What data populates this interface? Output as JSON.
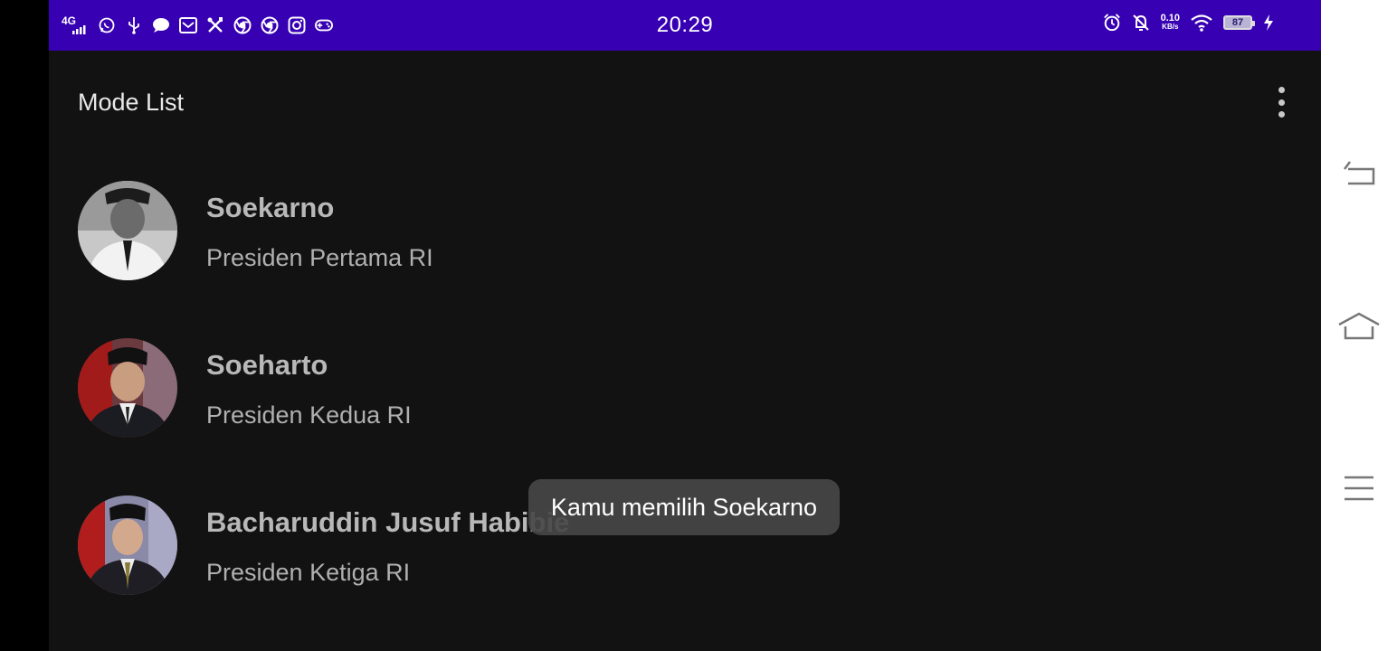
{
  "status_bar": {
    "time": "20:29",
    "network": "4G",
    "net_speed_value": "0.10",
    "net_speed_unit": "KB/s",
    "battery": "87",
    "left_icons": [
      "whatsapp-icon",
      "usb-icon",
      "message-icon",
      "mail-icon",
      "tools-icon",
      "chrome-icon",
      "chrome-icon",
      "instagram-icon",
      "gamepad-icon"
    ],
    "right_icons": [
      "alarm-icon",
      "notifications-off-icon",
      "wifi-icon",
      "battery-icon",
      "charging-icon"
    ]
  },
  "app_bar": {
    "title": "Mode List"
  },
  "list": {
    "items": [
      {
        "name": "Soekarno",
        "description": "Presiden Pertama RI"
      },
      {
        "name": "Soeharto",
        "description": "Presiden Kedua RI"
      },
      {
        "name": "Bacharuddin Jusuf Habibie",
        "description": "Presiden Ketiga RI"
      }
    ]
  },
  "toast": {
    "message": "Kamu memilih Soekarno"
  },
  "colors": {
    "status_bar": "#3700b3",
    "background": "#121212",
    "nav_bar": "#ffffff"
  },
  "nav_bar": {
    "buttons": [
      "back-icon",
      "home-icon",
      "menu-icon"
    ]
  }
}
